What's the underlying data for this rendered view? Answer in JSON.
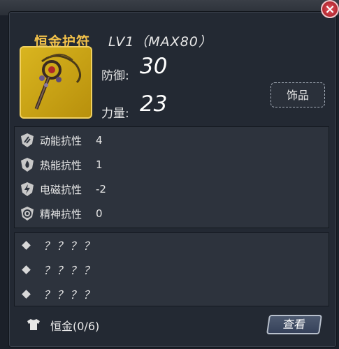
{
  "header": {
    "title": "恒金护符",
    "level": "LV1（MAX80）"
  },
  "stats": [
    {
      "label": "防御:",
      "value": "30"
    },
    {
      "label": "力量:",
      "value": "23"
    }
  ],
  "category_button": {
    "label": "饰品"
  },
  "resistances": [
    {
      "icon": "kinetic-icon",
      "label": "动能抗性",
      "value": "4"
    },
    {
      "icon": "thermal-icon",
      "label": "热能抗性",
      "value": "1"
    },
    {
      "icon": "electromagnetic-icon",
      "label": "电磁抗性",
      "value": "-2"
    },
    {
      "icon": "psychic-icon",
      "label": "精神抗性",
      "value": "0"
    }
  ],
  "unknown_affixes": [
    "？？？？",
    "？？？？",
    "？？？？"
  ],
  "set": {
    "label": "恒金(0/6)"
  },
  "view_button": {
    "label": "查看"
  },
  "colors": {
    "title": "#f2c14a",
    "item_bg": "#d9b51f",
    "panel": "#232933"
  }
}
